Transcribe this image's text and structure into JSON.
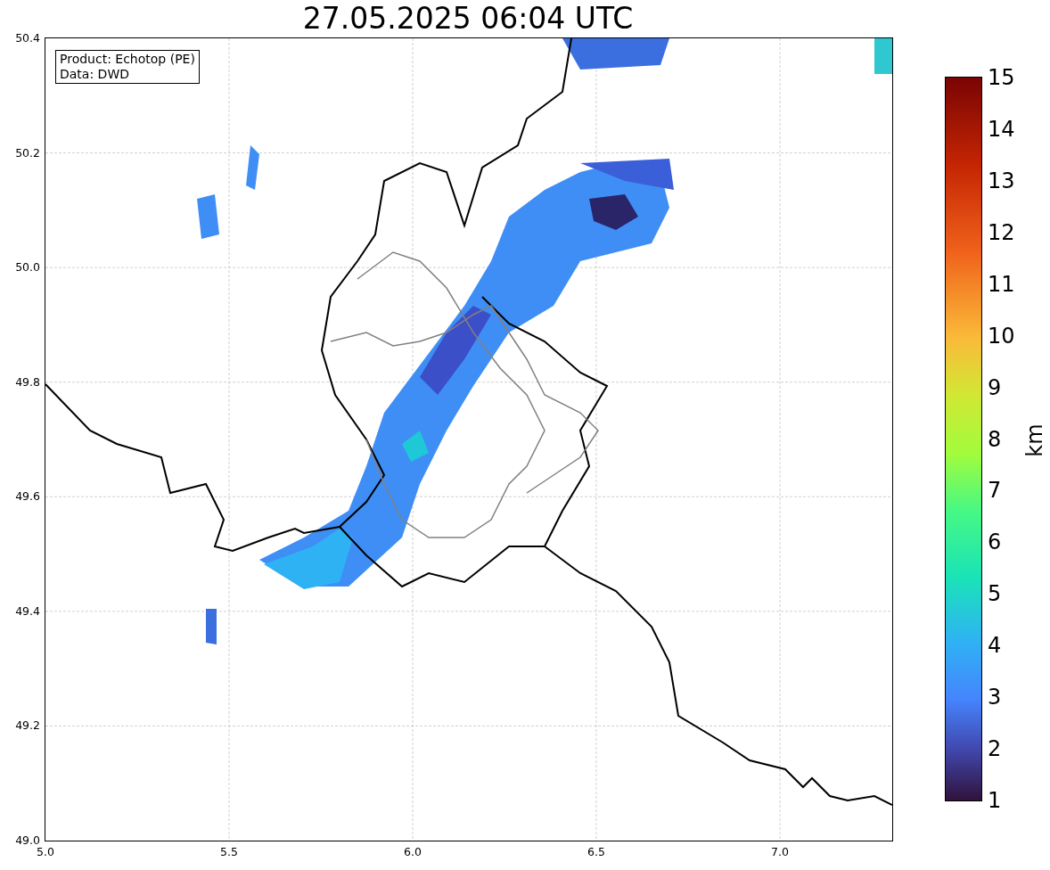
{
  "title": "27.05.2025 06:04 UTC",
  "info_box": {
    "lines": [
      "Product: Echotop (PE)",
      "Data: DWD"
    ]
  },
  "map": {
    "x_tick_labels": [
      "5.0",
      "5.5",
      "6.0",
      "6.5",
      "7.0"
    ],
    "y_tick_labels": [
      "50.4",
      "50.2",
      "50.0",
      "49.8",
      "49.6",
      "49.4",
      "49.2",
      "49.0"
    ]
  },
  "colorbar": {
    "label": "km",
    "tick_labels": [
      "15",
      "14",
      "13",
      "12",
      "11",
      "10",
      "9",
      "8",
      "7",
      "6",
      "5",
      "4",
      "3",
      "2",
      "1"
    ]
  }
}
